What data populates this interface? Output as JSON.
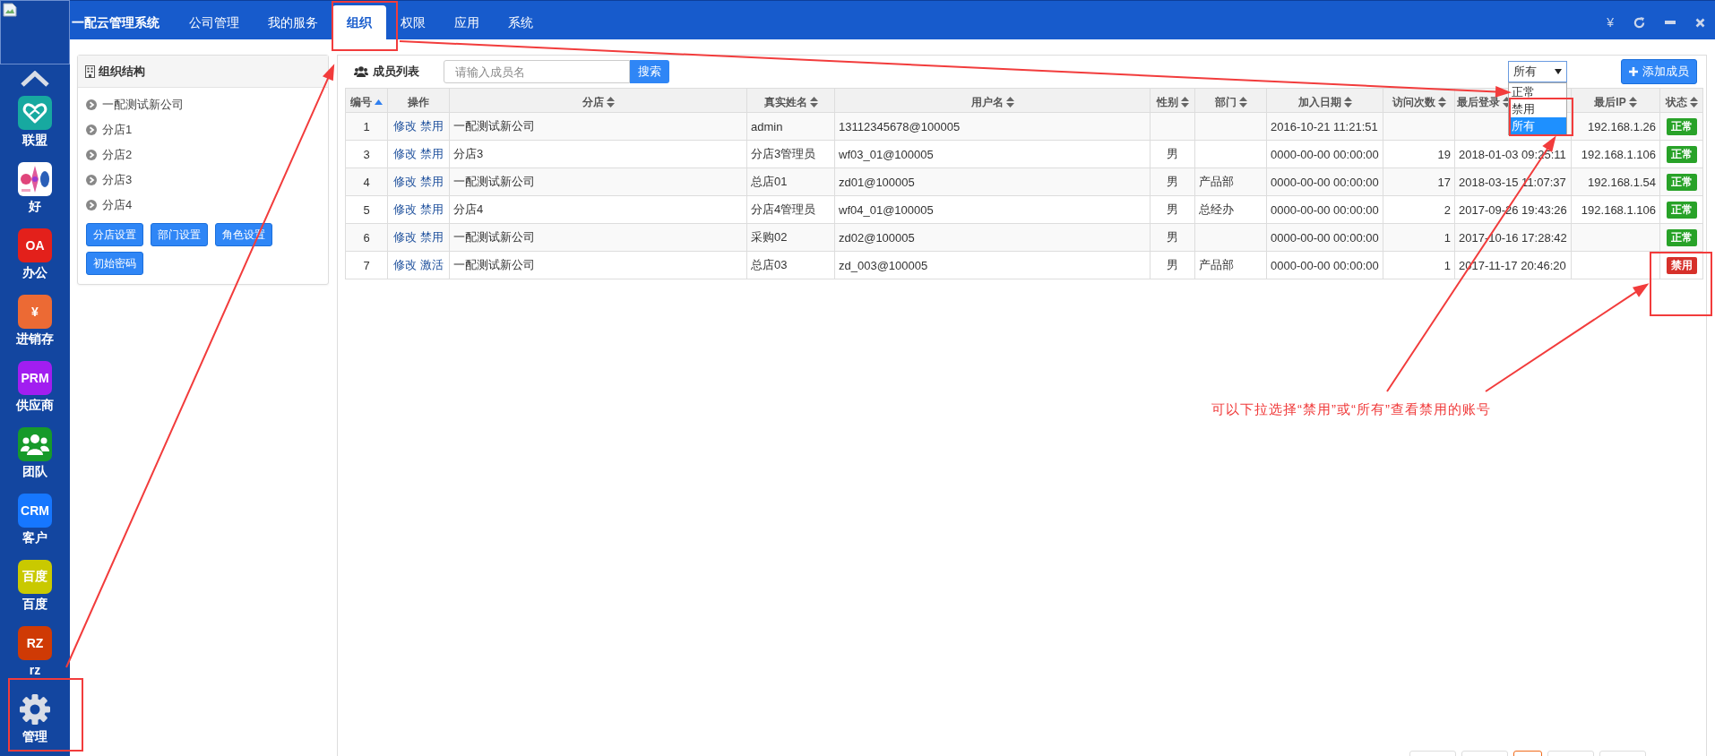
{
  "sidebar": {
    "items": [
      {
        "label": "联盟",
        "kind": "heart",
        "color": "#17a9a0"
      },
      {
        "label": "好",
        "kind": "picture",
        "color": "#ffffff"
      },
      {
        "label": "办公",
        "kind": "text",
        "icon_text": "OA",
        "color": "#e3201b"
      },
      {
        "label": "进销存",
        "kind": "text",
        "icon_text": "¥",
        "color": "#ec6a34"
      },
      {
        "label": "供应商",
        "kind": "text",
        "icon_text": "PRM",
        "color": "#a11ef0"
      },
      {
        "label": "团队",
        "kind": "team",
        "color": "#169a2a"
      },
      {
        "label": "客户",
        "kind": "text",
        "icon_text": "CRM",
        "color": "#1677ff"
      },
      {
        "label": "百度",
        "kind": "text",
        "icon_text": "百度",
        "color": "#c9c900"
      },
      {
        "label": "rz",
        "kind": "text",
        "icon_text": "RZ",
        "color": "#cf3a05"
      },
      {
        "label": "管理",
        "kind": "gear",
        "color": "#d9dde6"
      }
    ]
  },
  "topbar": {
    "title": "一配云管理系统",
    "tabs": [
      {
        "label": "公司管理",
        "selected": false
      },
      {
        "label": "我的服务",
        "selected": false
      },
      {
        "label": "组织",
        "selected": true
      },
      {
        "label": "权限",
        "selected": false
      },
      {
        "label": "应用",
        "selected": false
      },
      {
        "label": "系统",
        "selected": false
      }
    ],
    "currency_symbol": "¥"
  },
  "org_panel": {
    "title": "组织结构",
    "tree": [
      {
        "label": "一配测试新公司",
        "expanded": false
      },
      {
        "label": "分店1",
        "expanded": false
      },
      {
        "label": "分店2",
        "expanded": false
      },
      {
        "label": "分店3",
        "expanded": false
      },
      {
        "label": "分店4",
        "expanded": false
      }
    ],
    "buttons": [
      "分店设置",
      "部门设置",
      "角色设置",
      "初始密码"
    ]
  },
  "members": {
    "title": "成员列表",
    "search": {
      "placeholder": "请输入成员名"
    },
    "search_button": "搜索",
    "filter": {
      "value": "所有",
      "options": [
        {
          "label": "正常",
          "selected": false
        },
        {
          "label": "禁用",
          "selected": false
        },
        {
          "label": "所有",
          "selected": true
        }
      ]
    },
    "add_button": "添加成员",
    "table": {
      "columns": [
        {
          "label": "编号",
          "sortable": true,
          "sorted": true
        },
        {
          "label": "操作",
          "sortable": false,
          "sorted": false
        },
        {
          "label": "分店",
          "sortable": true,
          "sorted": false
        },
        {
          "label": "真实姓名",
          "sortable": true,
          "sorted": false
        },
        {
          "label": "用户名",
          "sortable": true,
          "sorted": false
        },
        {
          "label": "性别",
          "sortable": true,
          "sorted": false
        },
        {
          "label": "部门",
          "sortable": true,
          "sorted": false
        },
        {
          "label": "加入日期",
          "sortable": true,
          "sorted": false
        },
        {
          "label": "访问次数",
          "sortable": true,
          "sorted": false
        },
        {
          "label": "最后登录",
          "sortable": true,
          "sorted": false
        },
        {
          "label": "最后IP",
          "sortable": true,
          "sorted": false
        },
        {
          "label": "状态",
          "sortable": true,
          "sorted": false
        }
      ],
      "rows": [
        {
          "id": "1",
          "actions": [
            "修改",
            "禁用"
          ],
          "branch": "一配测试新公司",
          "real_name": "admin",
          "username": "13112345678@100005",
          "joined": "2016-10-21 11:21:51",
          "last_ip": "192.168.1.26",
          "status": {
            "label": "正常",
            "color": "#28a228"
          }
        },
        {
          "id": "3",
          "actions": [
            "修改",
            "禁用"
          ],
          "branch": "分店3",
          "real_name": "分店3管理员",
          "username": "wf03_01@100005",
          "gender": "男",
          "joined": "0000-00-00 00:00:00",
          "visits": "19",
          "last_login": "2018-01-03 09:25:11",
          "last_ip": "192.168.1.106",
          "status": {
            "label": "正常",
            "color": "#28a228"
          }
        },
        {
          "id": "4",
          "actions": [
            "修改",
            "禁用"
          ],
          "branch": "一配测试新公司",
          "real_name": "总店01",
          "username": "zd01@100005",
          "gender": "男",
          "dept": "产品部",
          "joined": "0000-00-00 00:00:00",
          "visits": "17",
          "last_login": "2018-03-15 11:07:37",
          "last_ip": "192.168.1.54",
          "status": {
            "label": "正常",
            "color": "#28a228"
          }
        },
        {
          "id": "5",
          "actions": [
            "修改",
            "禁用"
          ],
          "branch": "分店4",
          "real_name": "分店4管理员",
          "username": "wf04_01@100005",
          "gender": "男",
          "dept": "总经办",
          "joined": "0000-00-00 00:00:00",
          "visits": "2",
          "last_login": "2017-09-26 19:43:26",
          "last_ip": "192.168.1.106",
          "status": {
            "label": "正常",
            "color": "#28a228"
          }
        },
        {
          "id": "6",
          "actions": [
            "修改",
            "禁用"
          ],
          "branch": "一配测试新公司",
          "real_name": "采购02",
          "username": "zd02@100005",
          "gender": "男",
          "joined": "0000-00-00 00:00:00",
          "visits": "1",
          "last_login": "2017-10-16 17:28:42",
          "status": {
            "label": "正常",
            "color": "#28a228"
          }
        },
        {
          "id": "7",
          "actions": [
            "修改",
            "激活"
          ],
          "branch": "一配测试新公司",
          "real_name": "总店03",
          "username": "zd_003@100005",
          "gender": "男",
          "dept": "产品部",
          "joined": "0000-00-00 00:00:00",
          "visits": "1",
          "last_login": "2017-11-17 20:46:20",
          "status": {
            "label": "禁用",
            "color": "#d6302a"
          }
        }
      ]
    },
    "pager": [
      {
        "selected": false
      },
      {
        "selected": false
      },
      {
        "selected": true
      },
      {
        "selected": false
      },
      {
        "selected": false
      }
    ]
  },
  "annotation": {
    "text": "可以下拉选择“禁用”或“所有”查看禁用的账号"
  }
}
